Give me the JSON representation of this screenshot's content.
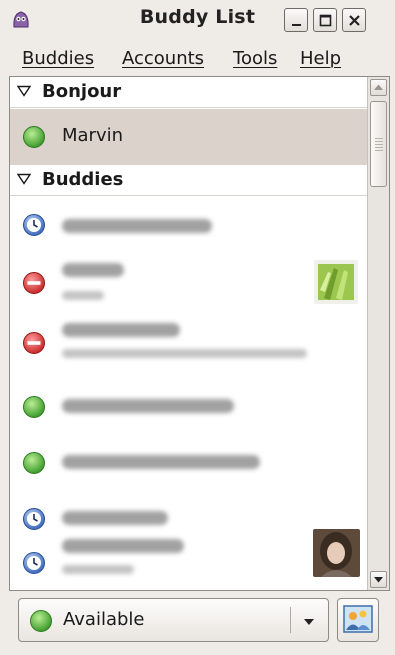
{
  "window": {
    "title": "Buddy List"
  },
  "menu": {
    "buddies": {
      "mnemonic": "B",
      "rest": "uddies"
    },
    "accounts": {
      "mnemonic": "A",
      "rest": "ccounts"
    },
    "tools": {
      "mnemonic": "T",
      "rest": "ools"
    },
    "help": {
      "mnemonic": "H",
      "rest": "elp"
    }
  },
  "groups": [
    {
      "label": "Bonjour",
      "buddies": [
        {
          "name": "Marvin",
          "status": "available",
          "selected": true
        }
      ]
    },
    {
      "label": "Buddies",
      "buddies": [
        {
          "name": "",
          "status": "idle",
          "obscured": true
        },
        {
          "name": "",
          "status": "busy",
          "obscured": true,
          "has_icon": true
        },
        {
          "name": "",
          "status": "busy",
          "obscured": true,
          "has_status_message": true
        },
        {
          "name": "",
          "status": "available",
          "obscured": true
        },
        {
          "name": "",
          "status": "available",
          "obscured": true
        },
        {
          "name": "",
          "status": "idle",
          "obscured": true
        },
        {
          "name": "",
          "status": "idle",
          "obscured": true,
          "has_icon": true
        }
      ]
    }
  ],
  "status_selector": {
    "value": "Available",
    "icon": "available-status-icon"
  },
  "icons": {
    "available": "green-circle-icon",
    "busy": "red-do-not-disturb-icon",
    "idle": "blue-clock-icon",
    "buddy_pounce": "buddy-pounce-icon"
  },
  "colors": {
    "available": "#4fb43c",
    "busy": "#d92b2b",
    "idle": "#3b6bc4",
    "selected_row": "#dbd3cb"
  }
}
